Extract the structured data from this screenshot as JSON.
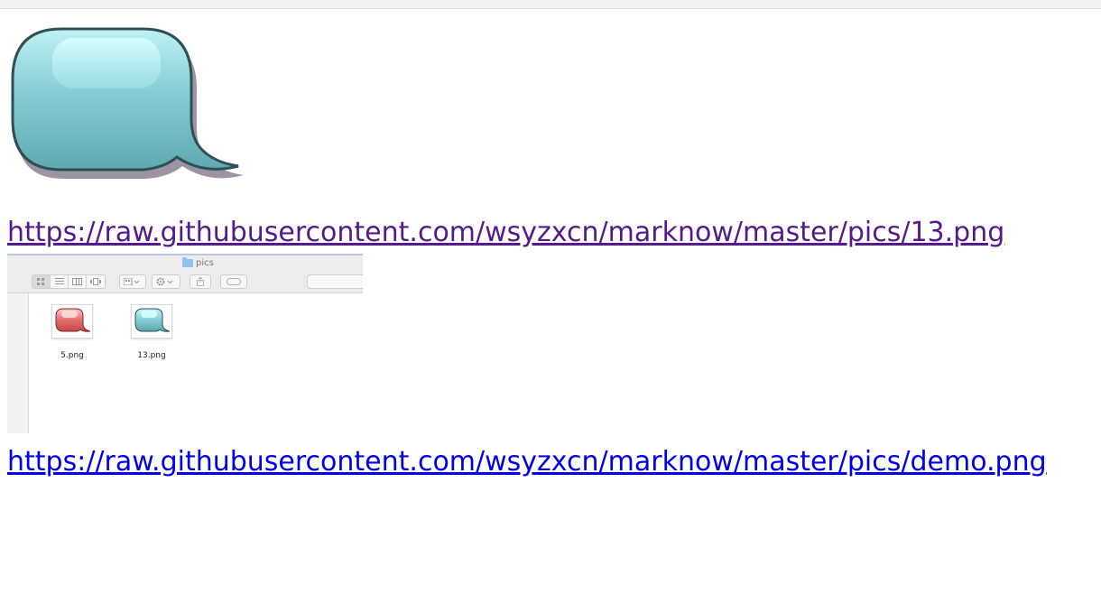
{
  "links": {
    "first_url": "https://raw.githubusercontent.com/wsyzxcn/marknow/master/pics/13.png",
    "second_url": "https://raw.githubusercontent.com/wsyzxcn/marknow/master/pics/demo.png"
  },
  "finder": {
    "window_title": "pics",
    "files": [
      {
        "name": "5.png",
        "icon": "red-speech-bubble-icon"
      },
      {
        "name": "13.png",
        "icon": "teal-speech-bubble-icon"
      }
    ]
  },
  "colors": {
    "visited_link": "#551a8b",
    "unvisited_link": "#0000ee",
    "bubble_teal": "#7cc9cf",
    "bubble_red": "#e06a6a"
  }
}
